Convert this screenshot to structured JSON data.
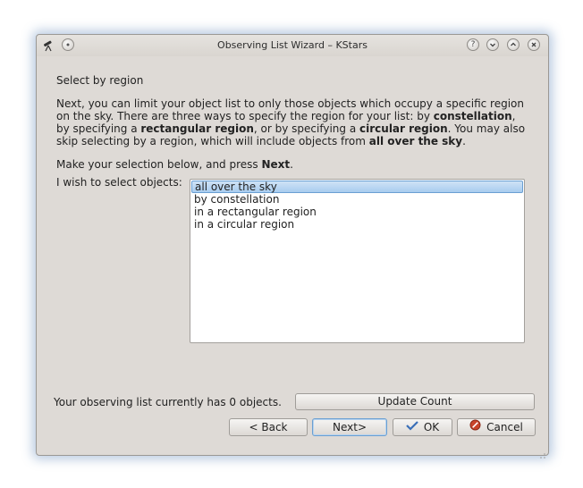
{
  "window": {
    "title": "Observing List Wizard – KStars"
  },
  "page": {
    "heading": "Select by region",
    "para": {
      "p1": "Next, you can limit your object list to only those objects which occupy a specific region on the sky. There are three ways to specify the region for your list: by ",
      "b1": "constellation",
      "p2": ", by specifying a ",
      "b2": "rectangular region",
      "p3": ", or by specifying a ",
      "b3": "circular region",
      "p4": ". You may also skip selecting by a region, which will include objects from ",
      "b4": "all over the sky",
      "p5": "."
    },
    "instruction": {
      "pre": "Make your selection below, and press ",
      "bold": "Next",
      "post": "."
    },
    "select_label": "I wish to select objects:",
    "options": [
      "all over the sky",
      "by constellation",
      "in a rectangular region",
      "in a circular region"
    ],
    "selected_index": 0,
    "count_text": "Your observing list currently has 0 objects."
  },
  "buttons": {
    "update_count": "Update Count",
    "back": "< Back",
    "next": "Next>",
    "ok": "OK",
    "cancel": "Cancel"
  },
  "icons": {
    "app": "telescope-icon",
    "ok": "checkmark-icon",
    "cancel": "cancel-icon"
  },
  "colors": {
    "window_bg": "#dedad6",
    "selection": "#a8ccef",
    "focus_border": "#6a9fd2"
  }
}
